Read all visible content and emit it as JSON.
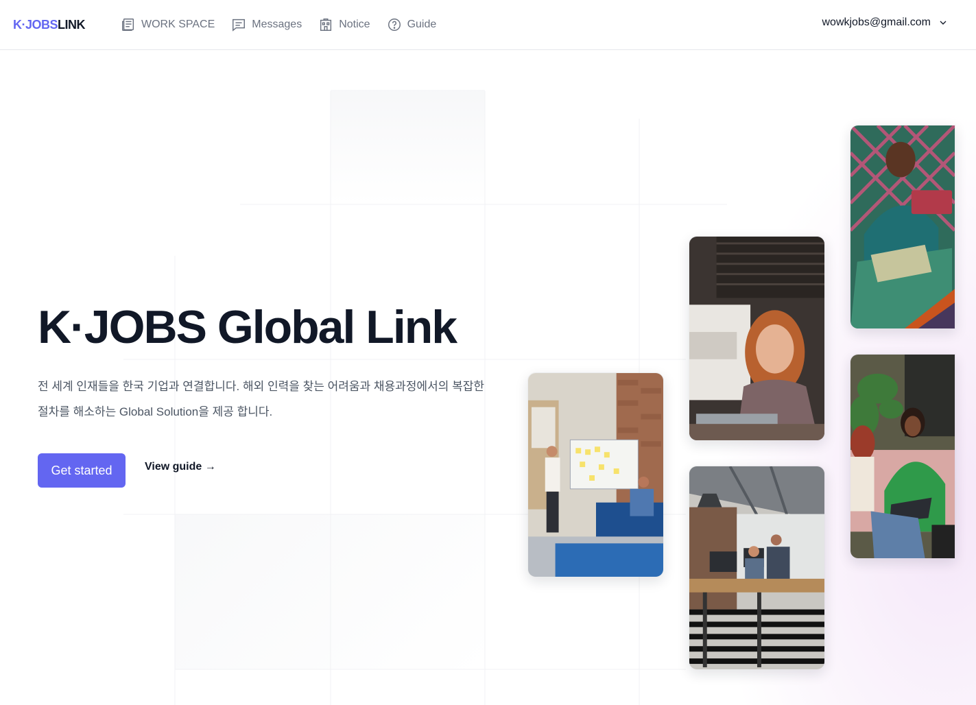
{
  "header": {
    "logo_part1": "K·JOBS",
    "logo_part2": "LINK",
    "nav": [
      {
        "label": "WORK SPACE",
        "icon": "newspaper-icon"
      },
      {
        "label": "Messages",
        "icon": "chat-icon"
      },
      {
        "label": "Notice",
        "icon": "building-icon"
      },
      {
        "label": "Guide",
        "icon": "question-circle-icon"
      }
    ],
    "account_email": "wowkjobs@gmail.com"
  },
  "hero": {
    "title": "K·JOBS Global Link",
    "description": "전 세계 인재들을 한국 기업과 연결합니다. 해외 인력을 찾는 어려움과 채용과정에서의 복잡한 절차를 해소하는 Global Solution을 제공 합니다.",
    "primary_button": "Get started",
    "secondary_link": "View guide →"
  },
  "colors": {
    "accent": "#6366f1",
    "text": "#111827",
    "muted": "#6b7280"
  }
}
